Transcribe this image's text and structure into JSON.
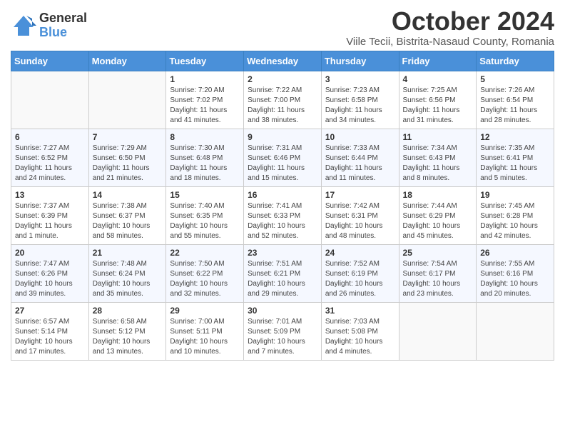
{
  "header": {
    "logo_general": "General",
    "logo_blue": "Blue",
    "month_title": "October 2024",
    "subtitle": "Viile Tecii, Bistrita-Nasaud County, Romania"
  },
  "days_of_week": [
    "Sunday",
    "Monday",
    "Tuesday",
    "Wednesday",
    "Thursday",
    "Friday",
    "Saturday"
  ],
  "weeks": [
    [
      {
        "day": "",
        "info": ""
      },
      {
        "day": "",
        "info": ""
      },
      {
        "day": "1",
        "info": "Sunrise: 7:20 AM\nSunset: 7:02 PM\nDaylight: 11 hours and 41 minutes."
      },
      {
        "day": "2",
        "info": "Sunrise: 7:22 AM\nSunset: 7:00 PM\nDaylight: 11 hours and 38 minutes."
      },
      {
        "day": "3",
        "info": "Sunrise: 7:23 AM\nSunset: 6:58 PM\nDaylight: 11 hours and 34 minutes."
      },
      {
        "day": "4",
        "info": "Sunrise: 7:25 AM\nSunset: 6:56 PM\nDaylight: 11 hours and 31 minutes."
      },
      {
        "day": "5",
        "info": "Sunrise: 7:26 AM\nSunset: 6:54 PM\nDaylight: 11 hours and 28 minutes."
      }
    ],
    [
      {
        "day": "6",
        "info": "Sunrise: 7:27 AM\nSunset: 6:52 PM\nDaylight: 11 hours and 24 minutes."
      },
      {
        "day": "7",
        "info": "Sunrise: 7:29 AM\nSunset: 6:50 PM\nDaylight: 11 hours and 21 minutes."
      },
      {
        "day": "8",
        "info": "Sunrise: 7:30 AM\nSunset: 6:48 PM\nDaylight: 11 hours and 18 minutes."
      },
      {
        "day": "9",
        "info": "Sunrise: 7:31 AM\nSunset: 6:46 PM\nDaylight: 11 hours and 15 minutes."
      },
      {
        "day": "10",
        "info": "Sunrise: 7:33 AM\nSunset: 6:44 PM\nDaylight: 11 hours and 11 minutes."
      },
      {
        "day": "11",
        "info": "Sunrise: 7:34 AM\nSunset: 6:43 PM\nDaylight: 11 hours and 8 minutes."
      },
      {
        "day": "12",
        "info": "Sunrise: 7:35 AM\nSunset: 6:41 PM\nDaylight: 11 hours and 5 minutes."
      }
    ],
    [
      {
        "day": "13",
        "info": "Sunrise: 7:37 AM\nSunset: 6:39 PM\nDaylight: 11 hours and 1 minute."
      },
      {
        "day": "14",
        "info": "Sunrise: 7:38 AM\nSunset: 6:37 PM\nDaylight: 10 hours and 58 minutes."
      },
      {
        "day": "15",
        "info": "Sunrise: 7:40 AM\nSunset: 6:35 PM\nDaylight: 10 hours and 55 minutes."
      },
      {
        "day": "16",
        "info": "Sunrise: 7:41 AM\nSunset: 6:33 PM\nDaylight: 10 hours and 52 minutes."
      },
      {
        "day": "17",
        "info": "Sunrise: 7:42 AM\nSunset: 6:31 PM\nDaylight: 10 hours and 48 minutes."
      },
      {
        "day": "18",
        "info": "Sunrise: 7:44 AM\nSunset: 6:29 PM\nDaylight: 10 hours and 45 minutes."
      },
      {
        "day": "19",
        "info": "Sunrise: 7:45 AM\nSunset: 6:28 PM\nDaylight: 10 hours and 42 minutes."
      }
    ],
    [
      {
        "day": "20",
        "info": "Sunrise: 7:47 AM\nSunset: 6:26 PM\nDaylight: 10 hours and 39 minutes."
      },
      {
        "day": "21",
        "info": "Sunrise: 7:48 AM\nSunset: 6:24 PM\nDaylight: 10 hours and 35 minutes."
      },
      {
        "day": "22",
        "info": "Sunrise: 7:50 AM\nSunset: 6:22 PM\nDaylight: 10 hours and 32 minutes."
      },
      {
        "day": "23",
        "info": "Sunrise: 7:51 AM\nSunset: 6:21 PM\nDaylight: 10 hours and 29 minutes."
      },
      {
        "day": "24",
        "info": "Sunrise: 7:52 AM\nSunset: 6:19 PM\nDaylight: 10 hours and 26 minutes."
      },
      {
        "day": "25",
        "info": "Sunrise: 7:54 AM\nSunset: 6:17 PM\nDaylight: 10 hours and 23 minutes."
      },
      {
        "day": "26",
        "info": "Sunrise: 7:55 AM\nSunset: 6:16 PM\nDaylight: 10 hours and 20 minutes."
      }
    ],
    [
      {
        "day": "27",
        "info": "Sunrise: 6:57 AM\nSunset: 5:14 PM\nDaylight: 10 hours and 17 minutes."
      },
      {
        "day": "28",
        "info": "Sunrise: 6:58 AM\nSunset: 5:12 PM\nDaylight: 10 hours and 13 minutes."
      },
      {
        "day": "29",
        "info": "Sunrise: 7:00 AM\nSunset: 5:11 PM\nDaylight: 10 hours and 10 minutes."
      },
      {
        "day": "30",
        "info": "Sunrise: 7:01 AM\nSunset: 5:09 PM\nDaylight: 10 hours and 7 minutes."
      },
      {
        "day": "31",
        "info": "Sunrise: 7:03 AM\nSunset: 5:08 PM\nDaylight: 10 hours and 4 minutes."
      },
      {
        "day": "",
        "info": ""
      },
      {
        "day": "",
        "info": ""
      }
    ]
  ]
}
